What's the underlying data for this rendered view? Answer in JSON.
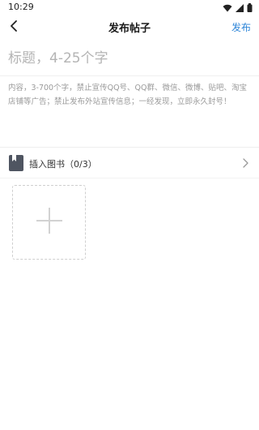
{
  "status_bar": {
    "time": "10:29",
    "icons": [
      "wifi-icon",
      "signal-icon",
      "battery-icon"
    ]
  },
  "header": {
    "title": "发布帖子",
    "publish_label": "发布",
    "back_icon": "chevron-left-icon",
    "publish_color": "#2f86d8"
  },
  "form": {
    "title_placeholder": "标题，4-25个字",
    "title_value": "",
    "content_placeholder": "内容，3-700个字，禁止宣传QQ号、QQ群、微信、微博、贴吧、淘宝店铺等广告；禁止发布外站宣传信息；一经发现，立即永久封号！",
    "content_value": ""
  },
  "insert_book": {
    "label": "插入图书（0/3）",
    "icon": "book-icon",
    "chevron_icon": "chevron-right-icon"
  },
  "upload": {
    "icon": "plus-icon"
  }
}
